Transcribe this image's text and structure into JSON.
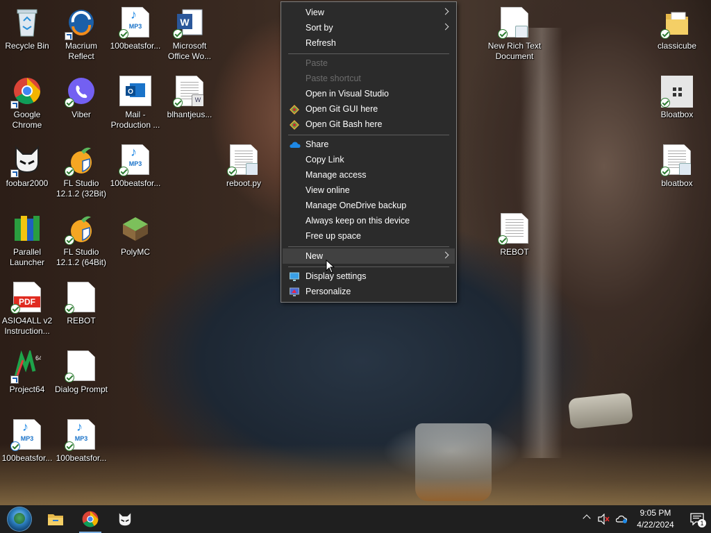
{
  "desktop": {
    "icons_left": [
      {
        "label": "Recycle Bin"
      },
      {
        "label": "Macrium Reflect"
      },
      {
        "label": "100beatsfor..."
      },
      {
        "label": "Microsoft Office Wo..."
      },
      {
        "label": "Google Chrome"
      },
      {
        "label": "Viber"
      },
      {
        "label": "Mail - Production ..."
      },
      {
        "label": "blhantjeus..."
      },
      {
        "label": "foobar2000"
      },
      {
        "label": "FL Studio 12.1.2 (32Bit)"
      },
      {
        "label": "100beatsfor..."
      },
      {
        "label": "reboot.py"
      },
      {
        "label": "Parallel Launcher"
      },
      {
        "label": "FL Studio 12.1.2 (64Bit)"
      },
      {
        "label": "PolyMC"
      },
      {
        "label": "ASIO4ALL v2 Instruction..."
      },
      {
        "label": "REBOT"
      },
      {
        "label": "Project64"
      },
      {
        "label": "Dialog Prompt"
      },
      {
        "label": "100beatsfor..."
      },
      {
        "label": "100beatsfor..."
      }
    ],
    "icons_right": [
      {
        "label": "New Rich Text Document"
      },
      {
        "label": "classicube"
      },
      {
        "label": "Bloatbox"
      },
      {
        "label": "bloatbox"
      },
      {
        "label": "REBOT"
      }
    ],
    "mp3_text": "MP3",
    "pdf_text": "PDF"
  },
  "context_menu": {
    "items": [
      {
        "label": "View"
      },
      {
        "label": "Sort by"
      },
      {
        "label": "Refresh"
      },
      {
        "label": "Paste"
      },
      {
        "label": "Paste shortcut"
      },
      {
        "label": "Open in Visual Studio"
      },
      {
        "label": "Open Git GUI here"
      },
      {
        "label": "Open Git Bash here"
      },
      {
        "label": "Share"
      },
      {
        "label": "Copy Link"
      },
      {
        "label": "Manage access"
      },
      {
        "label": "View online"
      },
      {
        "label": "Manage OneDrive backup"
      },
      {
        "label": "Always keep on this device"
      },
      {
        "label": "Free up space"
      },
      {
        "label": "New"
      },
      {
        "label": "Display settings"
      },
      {
        "label": "Personalize"
      }
    ]
  },
  "taskbar": {
    "pinned": [
      {
        "icon": "start-orb-icon"
      },
      {
        "icon": "file-explorer-icon"
      },
      {
        "icon": "chrome-icon"
      },
      {
        "icon": "foobar2000-icon"
      }
    ],
    "clock": {
      "time": "9:05 PM",
      "date": "4/22/2024"
    },
    "notification_count": "1"
  },
  "colors": {
    "menu_bg": "#2b2b2b",
    "menu_hover": "#414141",
    "taskbar_bg": "#1f1f1f",
    "sync_check": "#2e7d32"
  }
}
